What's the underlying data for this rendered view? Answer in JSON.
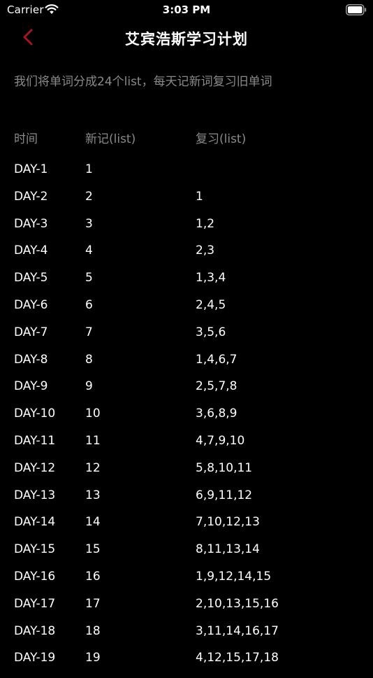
{
  "status_bar": {
    "carrier": "Carrier",
    "time": "3:03 PM"
  },
  "nav": {
    "title": "艾宾浩斯学习计划",
    "back_icon": "chevron-left-icon",
    "accent_color": "#a5161f"
  },
  "intro_text": "我们将单词分成24个list，每天记新词复习旧单词",
  "table": {
    "headers": {
      "day": "时间",
      "new": "新记(list)",
      "review": "复习(list)"
    },
    "rows": [
      {
        "day": "DAY-1",
        "new": "1",
        "review": ""
      },
      {
        "day": "DAY-2",
        "new": "2",
        "review": "1"
      },
      {
        "day": "DAY-3",
        "new": "3",
        "review": "1,2"
      },
      {
        "day": "DAY-4",
        "new": "4",
        "review": "2,3"
      },
      {
        "day": "DAY-5",
        "new": "5",
        "review": "1,3,4"
      },
      {
        "day": "DAY-6",
        "new": "6",
        "review": "2,4,5"
      },
      {
        "day": "DAY-7",
        "new": "7",
        "review": "3,5,6"
      },
      {
        "day": "DAY-8",
        "new": "8",
        "review": "1,4,6,7"
      },
      {
        "day": "DAY-9",
        "new": "9",
        "review": "2,5,7,8"
      },
      {
        "day": "DAY-10",
        "new": "10",
        "review": "3,6,8,9"
      },
      {
        "day": "DAY-11",
        "new": "11",
        "review": "4,7,9,10"
      },
      {
        "day": "DAY-12",
        "new": "12",
        "review": "5,8,10,11"
      },
      {
        "day": "DAY-13",
        "new": "13",
        "review": "6,9,11,12"
      },
      {
        "day": "DAY-14",
        "new": "14",
        "review": "7,10,12,13"
      },
      {
        "day": "DAY-15",
        "new": "15",
        "review": "8,11,13,14"
      },
      {
        "day": "DAY-16",
        "new": "16",
        "review": "1,9,12,14,15"
      },
      {
        "day": "DAY-17",
        "new": "17",
        "review": "2,10,13,15,16"
      },
      {
        "day": "DAY-18",
        "new": "18",
        "review": "3,11,14,16,17"
      },
      {
        "day": "DAY-19",
        "new": "19",
        "review": "4,12,15,17,18"
      }
    ]
  }
}
